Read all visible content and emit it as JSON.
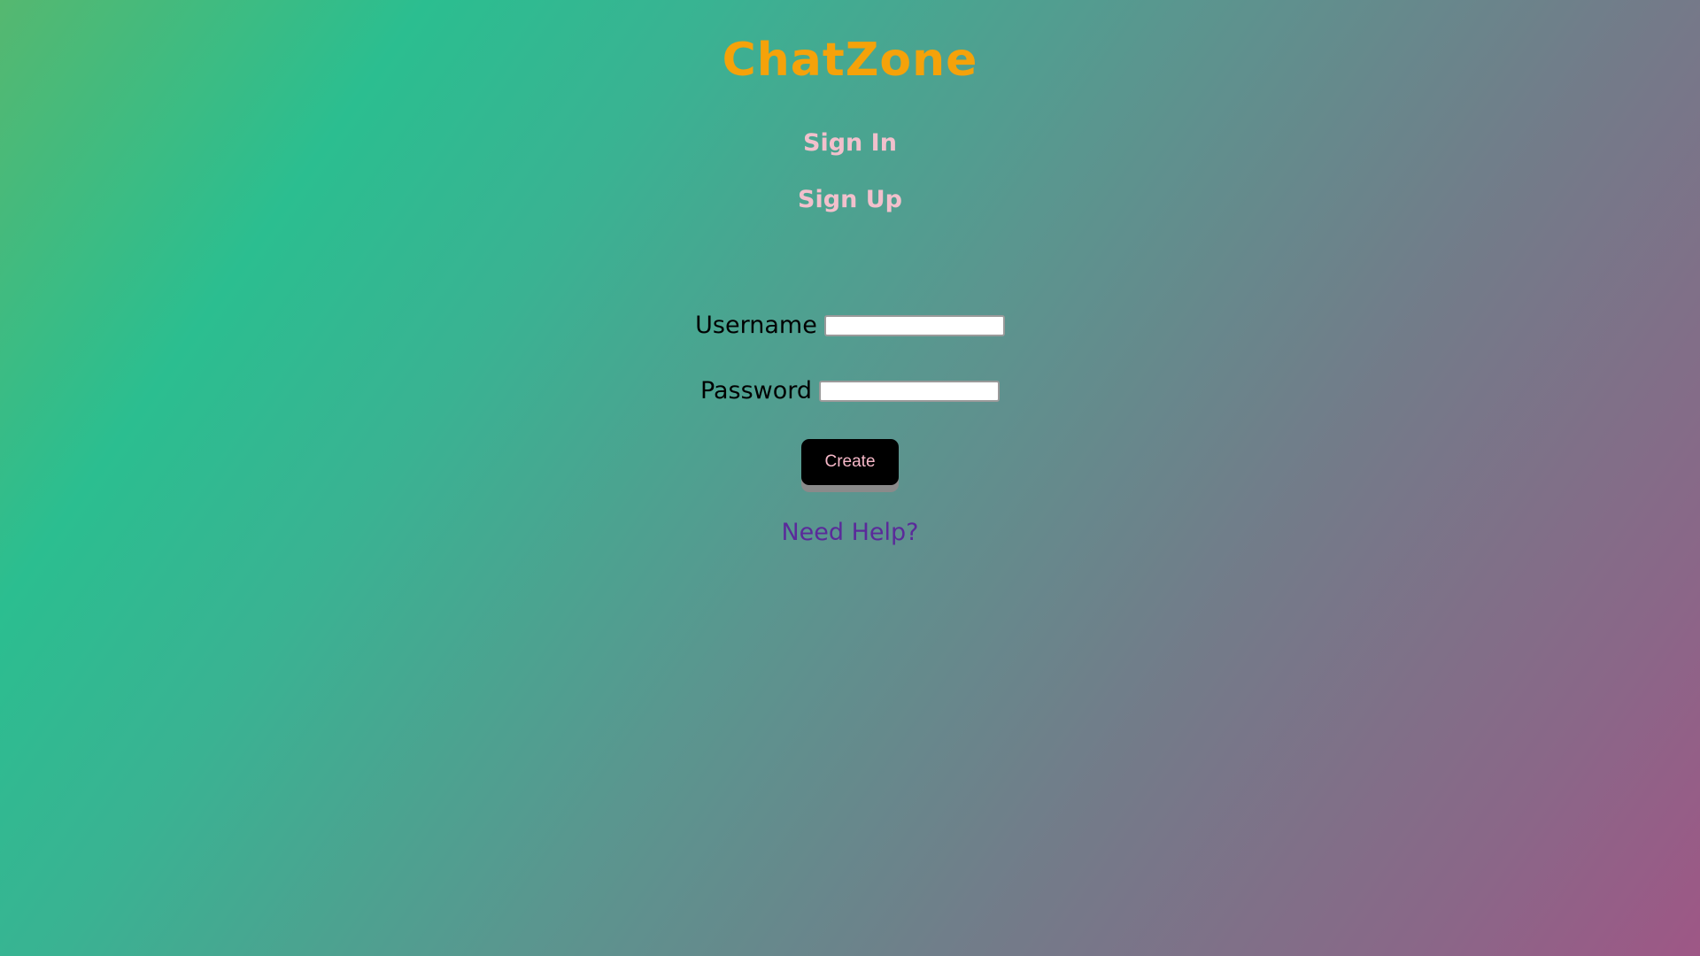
{
  "app": {
    "title": "ChatZone"
  },
  "nav": {
    "signin_label": "Sign In",
    "signup_label": "Sign Up"
  },
  "form": {
    "username_label": "Username",
    "username_value": "",
    "password_label": "Password",
    "password_value": "",
    "submit_label": "Create"
  },
  "help": {
    "label": "Need Help?"
  },
  "colors": {
    "title": "#f5a20a",
    "nav_link": "#f2c0cc",
    "button_text": "#f6b8c8",
    "help_link": "#5a2a9a"
  }
}
